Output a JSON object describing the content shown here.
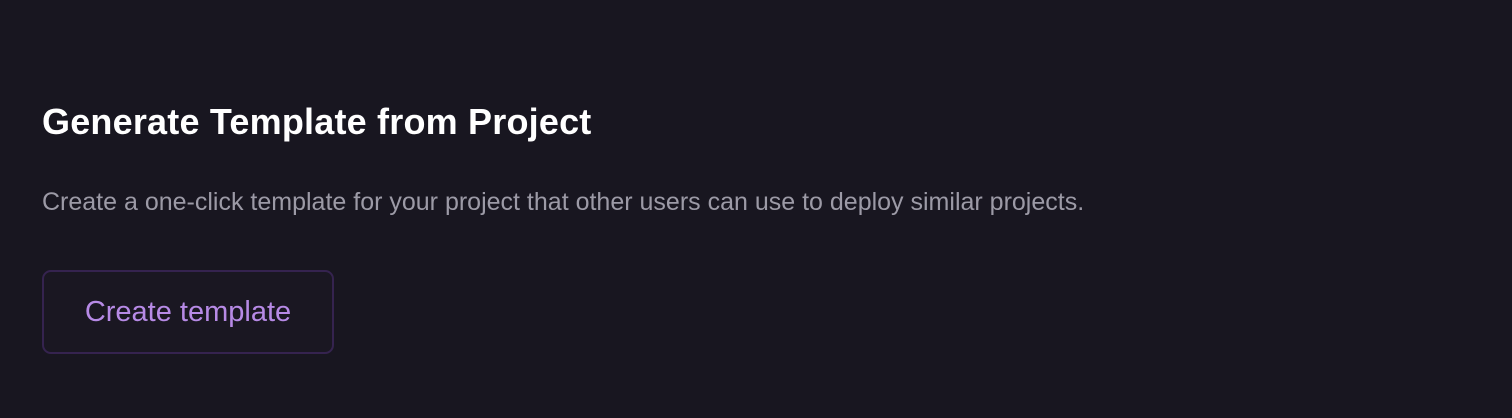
{
  "section": {
    "title": "Generate Template from Project",
    "description": "Create a one-click template for your project that other users can use to deploy similar projects.",
    "button_label": "Create template"
  },
  "colors": {
    "background": "#181620",
    "title": "#ffffff",
    "description": "#9c9aa6",
    "button_text": "#b78ae6",
    "button_border": "#35234f"
  }
}
